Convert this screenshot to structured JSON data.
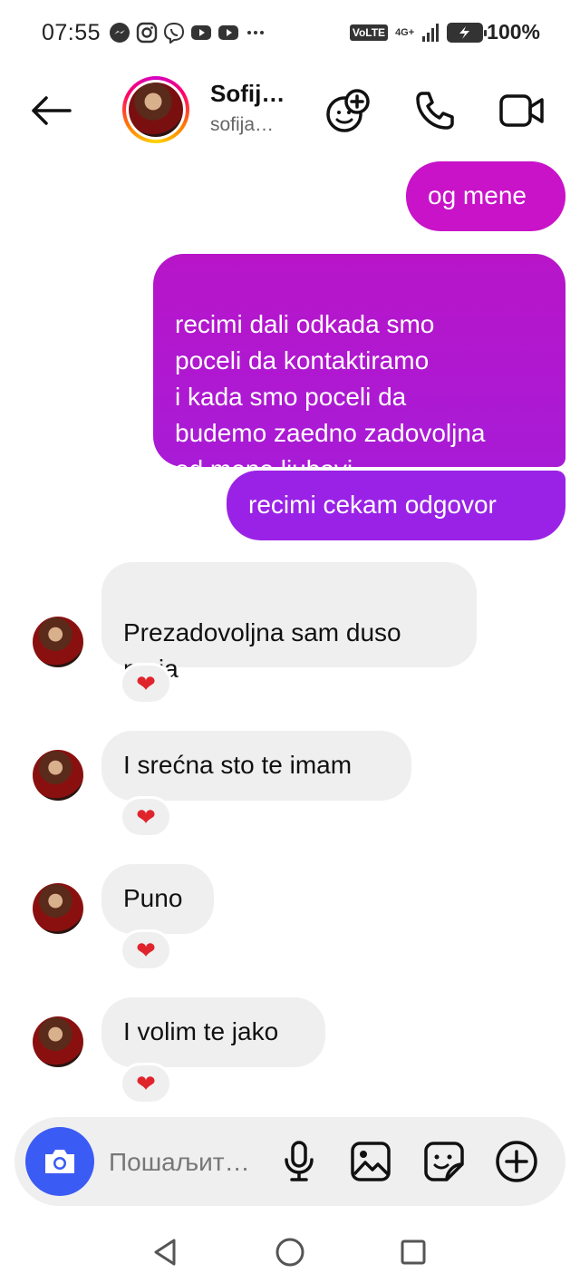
{
  "status_bar": {
    "time": "07:55",
    "app_icons": [
      "messenger-icon",
      "instagram-icon",
      "viber-icon",
      "youtube-icon",
      "youtube-icon",
      "more-dots-icon"
    ],
    "volte": "VoLTE",
    "network": "4G+",
    "battery_percent": "100%"
  },
  "header": {
    "contact_name": "Sofij…",
    "contact_username": "sofija…",
    "icons": [
      "back-arrow-icon",
      "add-people-icon",
      "phone-icon",
      "video-camera-icon"
    ]
  },
  "conversation": {
    "outgoing": [
      "og mene",
      "recimi dali odkada smo\npoceli da kontaktiramo\ni kada smo poceli da\nbudemo zaedno zadovoljna\nod mene ljubavi",
      "recimi cekam odgovor"
    ],
    "incoming": [
      {
        "text": "Prezadovoljna sam duso\nmoja",
        "reaction": "❤"
      },
      {
        "text": "I srećna sto te imam",
        "reaction": "❤"
      },
      {
        "text": "Puno",
        "reaction": "❤"
      },
      {
        "text": "I volim te jako",
        "reaction": "❤"
      }
    ]
  },
  "composer": {
    "placeholder": "Пошаљит…",
    "icons": [
      "camera-icon",
      "microphone-icon",
      "gallery-icon",
      "sticker-icon",
      "plus-icon"
    ]
  },
  "colors": {
    "outgoing_top": "#c813c8",
    "outgoing_bottom": "#9a22e6",
    "incoming_bg": "#efefef",
    "camera_button": "#3b5bf5",
    "reaction_heart": "#e0242c"
  },
  "nav_icons": [
    "back-triangle-icon",
    "home-circle-icon",
    "recents-square-icon"
  ]
}
